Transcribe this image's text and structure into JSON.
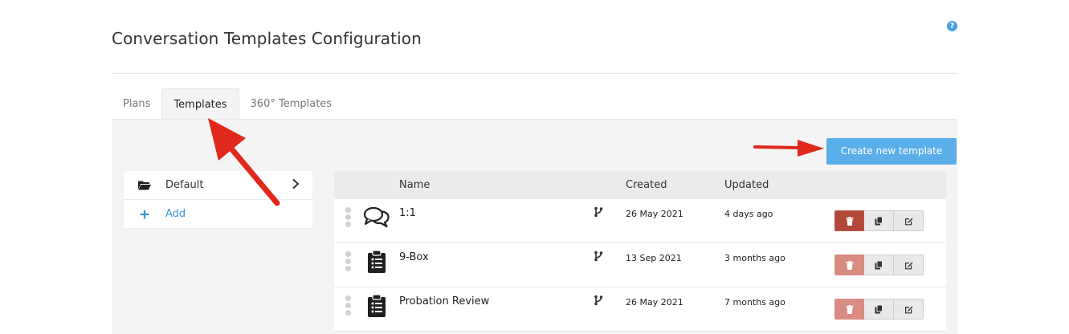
{
  "page": {
    "title": "Conversation Templates Configuration",
    "help_icon": "?"
  },
  "tabs": [
    {
      "label": "Plans",
      "active": false
    },
    {
      "label": "Templates",
      "active": true
    },
    {
      "label": "360° Templates",
      "active": false
    }
  ],
  "toolbar": {
    "create_label": "Create new template"
  },
  "folders": {
    "default_label": "Default",
    "add_label": "Add"
  },
  "table": {
    "columns": {
      "name": "Name",
      "created": "Created",
      "updated": "Updated"
    },
    "rows": [
      {
        "icon": "chat-bubbles-icon",
        "name": "1:1",
        "created": "26 May 2021",
        "updated": "4 days ago",
        "delete_enabled": true
      },
      {
        "icon": "clipboard-list-icon",
        "name": "9-Box",
        "created": "13 Sep 2021",
        "updated": "3 months ago",
        "delete_enabled": false
      },
      {
        "icon": "clipboard-list-icon",
        "name": "Probation Review",
        "created": "26 May 2021",
        "updated": "7 months ago",
        "delete_enabled": false
      }
    ]
  },
  "colors": {
    "accent": "#5aaeea",
    "delete": "#b3483a",
    "annotation_arrow": "#e0281c"
  }
}
